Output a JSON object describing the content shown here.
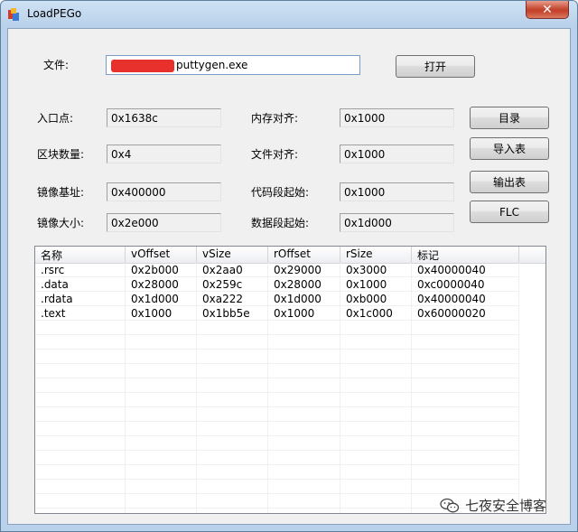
{
  "window": {
    "title": "LoadPEGo",
    "close_glyph": "✕"
  },
  "file": {
    "label": "文件:",
    "value": "puttygen.exe",
    "open_button": "打开"
  },
  "fields": {
    "entry_point": {
      "label": "入口点:",
      "value": "0x1638c"
    },
    "section_count": {
      "label": "区块数量:",
      "value": "0x4"
    },
    "image_base": {
      "label": "镜像基址:",
      "value": "0x400000"
    },
    "image_size": {
      "label": "镜像大小:",
      "value": "0x2e000"
    },
    "mem_align": {
      "label": "内存对齐:",
      "value": "0x1000"
    },
    "file_align": {
      "label": "文件对齐:",
      "value": "0x1000"
    },
    "code_start": {
      "label": "代码段起始:",
      "value": "0x1000"
    },
    "data_start": {
      "label": "数据段起始:",
      "value": "0x1d000"
    }
  },
  "buttons": {
    "directory": "目录",
    "import_table": "导入表",
    "export_table": "输出表",
    "flc": "FLC"
  },
  "sections_table": {
    "columns": [
      "名称",
      "vOffset",
      "vSize",
      "rOffset",
      "rSize",
      "标记"
    ],
    "rows": [
      [
        ".rsrc",
        "0x2b000",
        "0x2aa0",
        "0x29000",
        "0x3000",
        "0x40000040"
      ],
      [
        ".data",
        "0x28000",
        "0x259c",
        "0x28000",
        "0x1000",
        "0xc0000040"
      ],
      [
        ".rdata",
        "0x1d000",
        "0xa222",
        "0x1d000",
        "0xb000",
        "0x40000040"
      ],
      [
        ".text",
        "0x1000",
        "0x1bb5e",
        "0x1000",
        "0x1c000",
        "0x60000020"
      ]
    ]
  },
  "watermark": {
    "text": "七夜安全博客"
  },
  "icons": {
    "app": "app-icon",
    "wechat": "wechat-icon"
  }
}
